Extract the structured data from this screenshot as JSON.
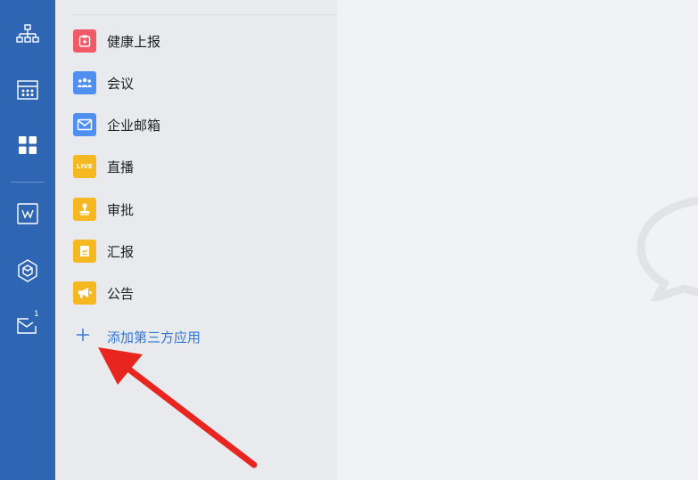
{
  "rail": {
    "items": [
      {
        "icon": "org-chart-icon"
      },
      {
        "icon": "calendar-icon"
      },
      {
        "icon": "apps-grid-icon",
        "active": true
      },
      {
        "icon": "document-w-icon"
      },
      {
        "icon": "hexagon-icon"
      },
      {
        "icon": "mail-icon",
        "badge": "1"
      }
    ]
  },
  "apps": {
    "items": [
      {
        "label": "健康上报",
        "icon": "health-report-icon",
        "color": "#f05a66"
      },
      {
        "label": "会议",
        "icon": "meeting-icon",
        "color": "#4f8ff0"
      },
      {
        "label": "企业邮箱",
        "icon": "mail-icon",
        "color": "#4f8ff0"
      },
      {
        "label": "直播",
        "icon": "live-icon",
        "icon_text": "LIVE",
        "color": "#f5b820"
      },
      {
        "label": "审批",
        "icon": "approval-stamp-icon",
        "color": "#f5b820"
      },
      {
        "label": "汇报",
        "icon": "report-icon",
        "color": "#f5b820"
      },
      {
        "label": "公告",
        "icon": "announcement-icon",
        "color": "#f5b820"
      }
    ],
    "add_third_party_label": "添加第三方应用"
  },
  "colors": {
    "rail": "#2f66b4",
    "panel": "#e9eaee",
    "main": "#f1f2f5",
    "link": "#2f75d6",
    "annotation": "#e8251f"
  }
}
